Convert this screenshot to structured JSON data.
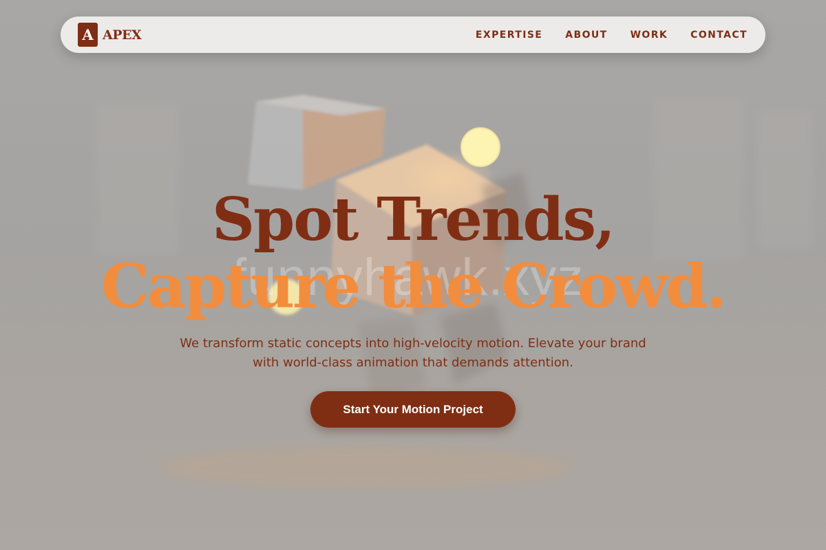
{
  "site": {
    "brand_mark": "A",
    "brand_name": "APEX"
  },
  "nav": {
    "items": [
      {
        "label": "EXPERTISE"
      },
      {
        "label": "ABOUT"
      },
      {
        "label": "WORK"
      },
      {
        "label": "CONTACT"
      }
    ]
  },
  "hero": {
    "headline_line1": "Spot Trends,",
    "headline_line2": "Capture the Crowd.",
    "subtitle": "We transform static concepts into high-velocity motion. Elevate your brand with world-class animation that demands attention.",
    "cta_label": "Start Your Motion Project",
    "background_watermark": "funnyhawk.xyz"
  },
  "colors": {
    "brand_dark": "#7f2e14",
    "brand_accent": "#f28d3e",
    "navbar_bg": "#ecebea",
    "page_bg": "#a5a3a1",
    "cta_text": "#ffffff"
  },
  "icons": {
    "brand_logo": "letter-a-square-icon"
  }
}
